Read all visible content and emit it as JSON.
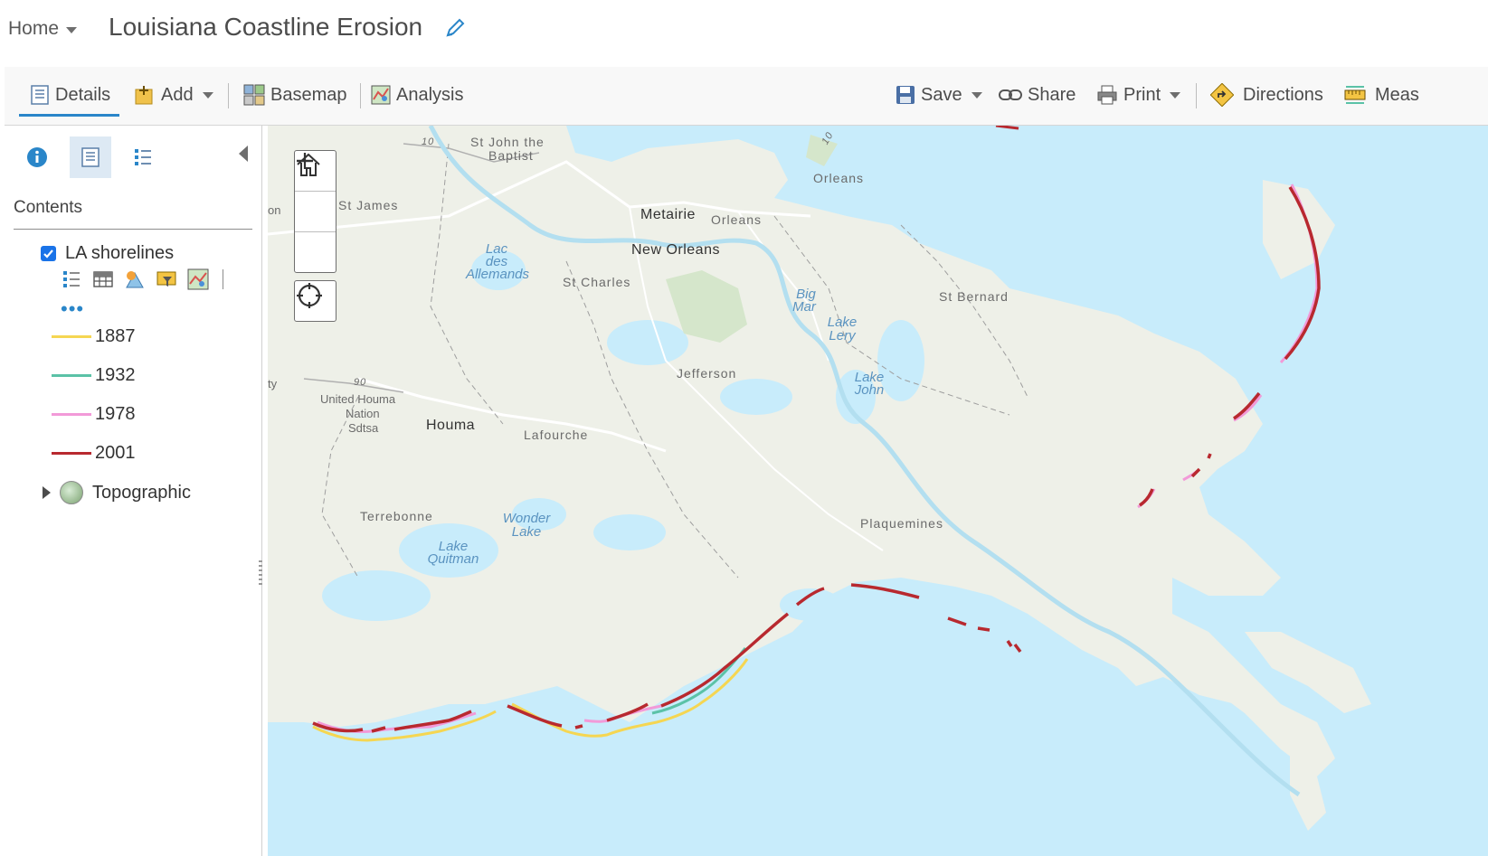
{
  "header": {
    "home_label": "Home",
    "title": "Louisiana Coastline Erosion"
  },
  "toolbar": {
    "details": "Details",
    "add": "Add",
    "basemap": "Basemap",
    "analysis": "Analysis",
    "save": "Save",
    "share": "Share",
    "print": "Print",
    "directions": "Directions",
    "measure": "Meas"
  },
  "panel": {
    "contents_label": "Contents",
    "layer": {
      "name": "LA shorelines",
      "checked": true
    },
    "more_label": "•••",
    "legend": [
      {
        "label": "1887",
        "color": "#f5d652"
      },
      {
        "label": "1932",
        "color": "#5bc2a7"
      },
      {
        "label": "1978",
        "color": "#f29ad8"
      },
      {
        "label": "2001",
        "color": "#b8292f"
      }
    ],
    "basemap_layer": "Topographic"
  },
  "map": {
    "labels": {
      "st_john": "St John the",
      "baptist": "Baptist",
      "orleans_top": "Orleans",
      "st_james": "St James",
      "metairie": "Metairie",
      "orleans_mid": "Orleans",
      "new_orleans": "New Orleans",
      "lac": "Lac",
      "des": "des",
      "allemands": "Allemands",
      "st_charles": "St Charles",
      "st_bernard": "St Bernard",
      "big": "Big",
      "mar": "Mar",
      "lake_lery_1": "Lake",
      "lake_lery_2": "Lery",
      "jefferson": "Jefferson",
      "lake_john_1": "Lake",
      "lake_john_2": "John",
      "united_houma_1": "United Houma",
      "united_houma_2": "Nation",
      "united_houma_3": "Sdtsa",
      "houma": "Houma",
      "lafourche": "Lafourche",
      "terrebonne": "Terrebonne",
      "wonder_1": "Wonder",
      "wonder_2": "Lake",
      "quitman_1": "Lake",
      "quitman_2": "Quitman",
      "plaquemines": "Plaquemines",
      "on": "on",
      "ty": "ty",
      "route_10": "10",
      "route_10b": "10",
      "route_90": "90"
    }
  }
}
